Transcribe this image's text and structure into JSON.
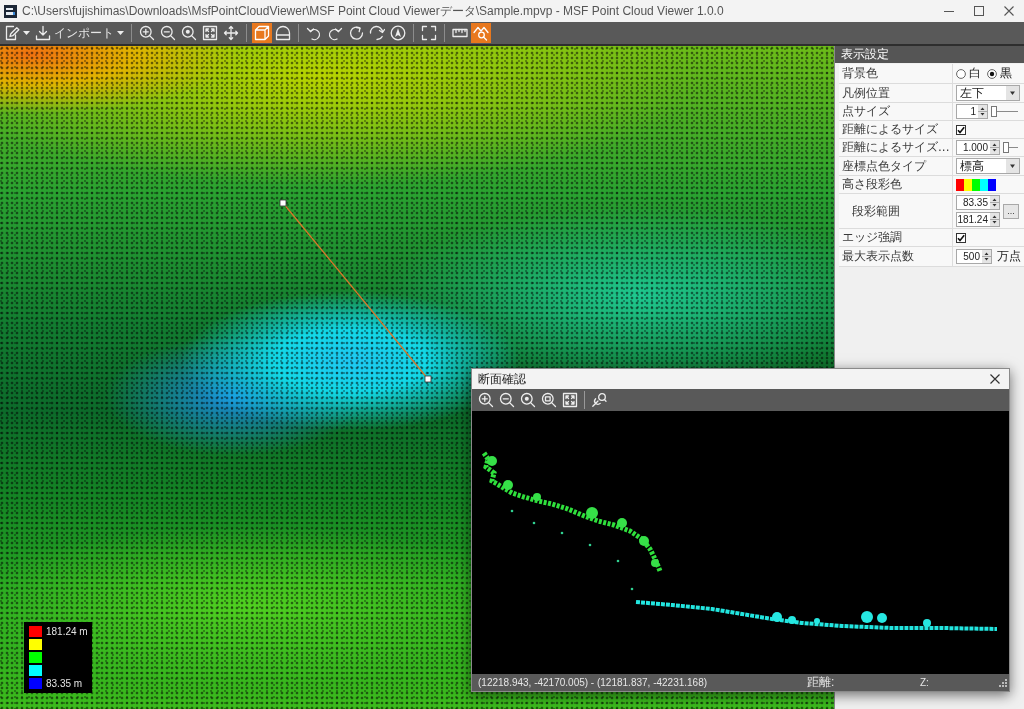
{
  "window": {
    "title": "C:\\Users\\fujishimas\\Downloads\\MsfPointCloudViewer\\MSF Point Cloud Viewerデータ\\Sample.mpvp - MSF Point Cloud Viewer 1.0.0"
  },
  "toolbar": {
    "groups": [
      [
        {
          "kind": "menu",
          "selected": false
        },
        {
          "kind": "menu",
          "label": "インポート",
          "selected": false
        }
      ],
      [
        {
          "kind": "button",
          "selected": false
        },
        {
          "kind": "button",
          "selected": false
        },
        {
          "kind": "button",
          "selected": false
        },
        {
          "kind": "button",
          "selected": false
        },
        {
          "kind": "button",
          "selected": false
        }
      ],
      [
        {
          "kind": "button",
          "selected": true
        },
        {
          "kind": "button",
          "selected": false
        }
      ],
      [
        {
          "kind": "button",
          "selected": false
        },
        {
          "kind": "button",
          "selected": false
        },
        {
          "kind": "button",
          "selected": false
        },
        {
          "kind": "button",
          "selected": false
        },
        {
          "kind": "button",
          "selected": false
        }
      ],
      [
        {
          "kind": "button",
          "selected": false
        }
      ],
      [
        {
          "kind": "button",
          "selected": false
        },
        {
          "kind": "button",
          "selected": true
        }
      ]
    ]
  },
  "legend": {
    "entries": [
      {
        "color": "#ff0000",
        "label": "181.24 m"
      },
      {
        "color": "#ffff00"
      },
      {
        "color": "#00ff00"
      },
      {
        "color": "#00ffff"
      },
      {
        "color": "#0000ff",
        "label": "83.35 m"
      }
    ]
  },
  "panel": {
    "title": "表示設定",
    "rows": [
      {
        "kind": "radio",
        "label": "背景色",
        "options": [
          {
            "label": "白",
            "selected": false
          },
          {
            "label": "黒",
            "selected": true
          }
        ]
      },
      {
        "kind": "dropdown",
        "label": "凡例位置",
        "value": "左下"
      },
      {
        "kind": "spin-slider",
        "label": "点サイズ",
        "value": "1",
        "level": 0
      },
      {
        "kind": "checkbox",
        "label": "距離によるサイズ",
        "checked": true
      },
      {
        "kind": "spin-slider",
        "label": "距離によるサイズ...",
        "value": "1.000",
        "level": 0
      },
      {
        "kind": "dropdown",
        "label": "座標点色タイプ",
        "value": "標高"
      },
      {
        "kind": "swatches",
        "label": "高さ段彩色",
        "colors": [
          {
            "color": "#ff0000"
          },
          {
            "color": "#ffff00"
          },
          {
            "color": "#00ff00"
          },
          {
            "color": "#00ffff"
          },
          {
            "color": "#0000ff"
          }
        ]
      },
      {
        "kind": "range",
        "label": "段彩範囲",
        "values": [
          "83.35",
          "181.24"
        ],
        "button": "..."
      },
      {
        "kind": "checkbox",
        "label": "エッジ強調",
        "checked": true
      },
      {
        "kind": "spin",
        "label": "最大表示点数",
        "value": "500",
        "unit": "万点"
      }
    ]
  },
  "section_window": {
    "title": "断面確認",
    "status": {
      "coords": "(12218.943, -42170.005) - (12181.837, -42231.168)",
      "distance_label": "距離:",
      "z_label": "Z:"
    }
  }
}
